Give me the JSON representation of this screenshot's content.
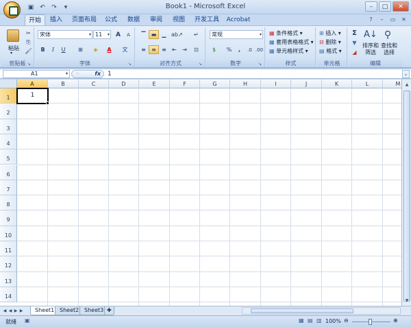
{
  "window": {
    "title": "Book1 - Microsoft Excel"
  },
  "qat": [
    "save-icon",
    "undo-icon",
    "redo-icon",
    "customize-icon"
  ],
  "tabs": [
    {
      "label": "开始",
      "active": true
    },
    {
      "label": "插入"
    },
    {
      "label": "页面布局"
    },
    {
      "label": "公式"
    },
    {
      "label": "数据"
    },
    {
      "label": "审阅"
    },
    {
      "label": "视图"
    },
    {
      "label": "开发工具"
    },
    {
      "label": "Acrobat"
    }
  ],
  "ribbon": {
    "clipboard": {
      "label": "剪贴板",
      "paste": "粘贴"
    },
    "font": {
      "label": "字体",
      "name": "宋体",
      "size": "11",
      "bold": "B",
      "italic": "I",
      "underline": "U",
      "grow": "A",
      "shrink": "A",
      "color_letter": "A",
      "phonetic": "文"
    },
    "alignment": {
      "label": "对齐方式"
    },
    "number": {
      "label": "数字",
      "format": "常规",
      "percent": "%",
      "comma": ","
    },
    "styles": {
      "label": "样式",
      "conditional": "条件格式",
      "table": "套用表格格式",
      "cell": "单元格样式"
    },
    "cells": {
      "label": "单元格",
      "insert": "插入",
      "delete": "删除",
      "format": "格式"
    },
    "editing": {
      "label": "编辑",
      "sort": "排序和\n筛选",
      "find": "查找和\n选择",
      "sigma": "Σ"
    }
  },
  "formula_bar": {
    "name_box": "A1",
    "fx": "fx",
    "value": "1"
  },
  "columns": [
    "A",
    "B",
    "C",
    "D",
    "E",
    "F",
    "G",
    "H",
    "I",
    "J",
    "K",
    "L",
    "M"
  ],
  "rows": [
    "1",
    "2",
    "3",
    "4",
    "5",
    "6",
    "7",
    "8",
    "9",
    "10",
    "11",
    "12",
    "13",
    "14"
  ],
  "cells": {
    "A1": "1"
  },
  "sheets": [
    {
      "label": "Sheet1",
      "active": true
    },
    {
      "label": "Sheet2"
    },
    {
      "label": "Sheet3"
    }
  ],
  "status": {
    "ready": "就绪",
    "zoom": "100%"
  },
  "colors": {
    "accent": "#f6c862",
    "ribbon": "#dbe7f6",
    "grid": "#d4dde8"
  }
}
